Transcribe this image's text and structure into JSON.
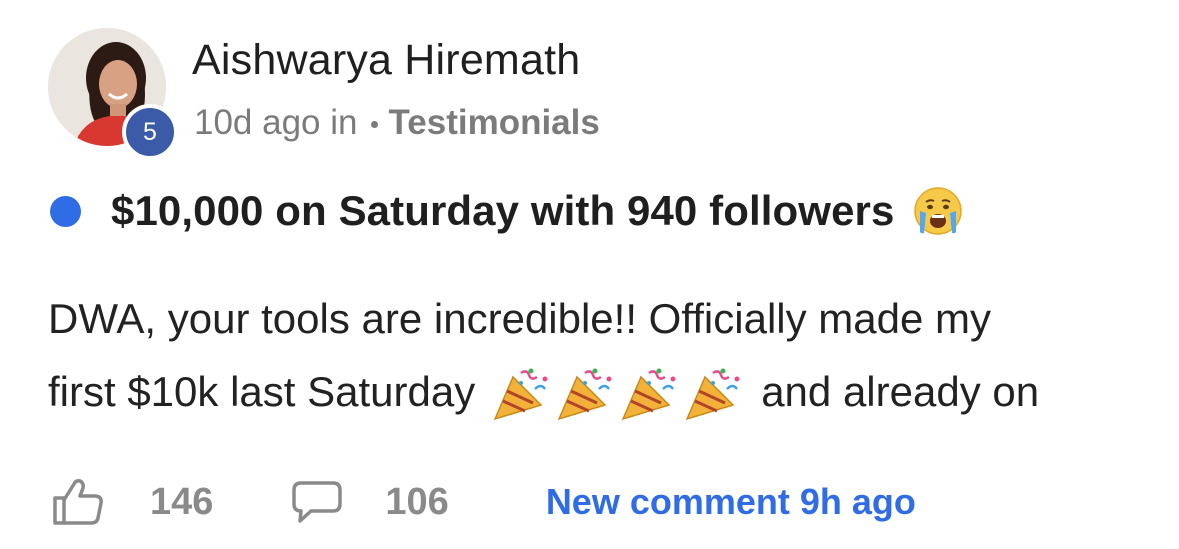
{
  "post": {
    "author": {
      "name": "Aishwarya Hiremath",
      "level": "5"
    },
    "meta": {
      "time": "10d ago in",
      "category": "Testimonials"
    },
    "title": "$10,000 on Saturday with 940 followers",
    "body": {
      "line1": "DWA, your tools are incredible!! Officially made my",
      "line2_start": "first $10k last Saturday",
      "line2_end": "and already on"
    },
    "footer": {
      "likes": "146",
      "comments": "106",
      "new_comment": "New comment 9h ago"
    }
  },
  "icons": {
    "avatar": "avatar-photo",
    "unread": "unread-dot",
    "title_emoji": "crying-face-emoji",
    "body_emoji": "party-popper-emoji",
    "like": "thumbs-up-icon",
    "comment": "speech-bubble-icon"
  },
  "colors": {
    "accent": "#2f6ce5",
    "badge": "#3b5ba9",
    "muted": "#7b7b7b",
    "text": "#1f1f1f"
  }
}
